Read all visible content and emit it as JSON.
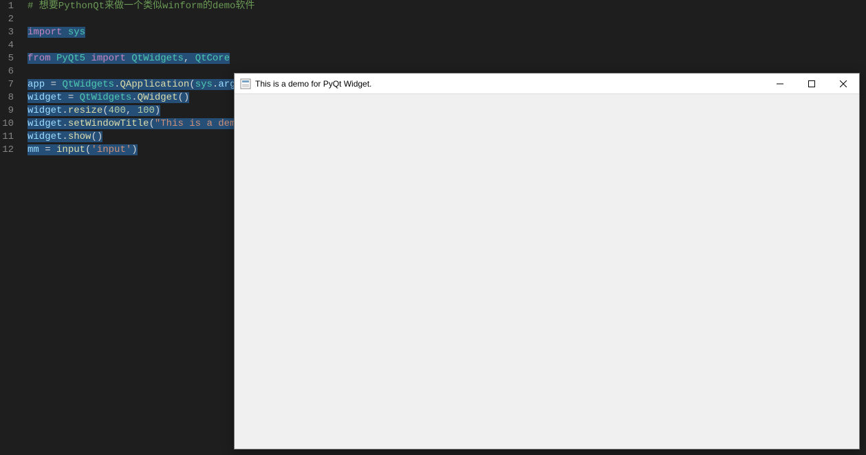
{
  "editor": {
    "lines": [
      {
        "n": 1,
        "tokens": [
          {
            "t": "# 想要PythonQt来做一个类似winform的demo软件",
            "c": "cm"
          }
        ]
      },
      {
        "n": 2,
        "tokens": []
      },
      {
        "n": 3,
        "tokens": [
          {
            "t": "import",
            "c": "kw"
          },
          {
            "t": " ",
            "c": "pn"
          },
          {
            "t": "sys",
            "c": "mod"
          }
        ],
        "selected": true
      },
      {
        "n": 4,
        "tokens": []
      },
      {
        "n": 5,
        "tokens": [
          {
            "t": "from",
            "c": "kw"
          },
          {
            "t": " ",
            "c": "pn"
          },
          {
            "t": "PyQt5",
            "c": "mod"
          },
          {
            "t": " ",
            "c": "pn"
          },
          {
            "t": "import",
            "c": "kw"
          },
          {
            "t": " ",
            "c": "pn"
          },
          {
            "t": "QtWidgets",
            "c": "mod"
          },
          {
            "t": ", ",
            "c": "pn"
          },
          {
            "t": "QtCore",
            "c": "mod"
          }
        ],
        "selected": true
      },
      {
        "n": 6,
        "tokens": []
      },
      {
        "n": 7,
        "tokens": [
          {
            "t": "app",
            "c": "id"
          },
          {
            "t": " = ",
            "c": "pn"
          },
          {
            "t": "QtWidgets",
            "c": "mod"
          },
          {
            "t": ".",
            "c": "pn"
          },
          {
            "t": "QApplication",
            "c": "fn"
          },
          {
            "t": "(",
            "c": "pn"
          },
          {
            "t": "sys",
            "c": "mod"
          },
          {
            "t": ".",
            "c": "pn"
          },
          {
            "t": "argv",
            "c": "id"
          },
          {
            "t": ")",
            "c": "pn"
          }
        ],
        "selected": true
      },
      {
        "n": 8,
        "tokens": [
          {
            "t": "widget",
            "c": "id"
          },
          {
            "t": " = ",
            "c": "pn"
          },
          {
            "t": "QtWidgets",
            "c": "mod"
          },
          {
            "t": ".",
            "c": "pn"
          },
          {
            "t": "QWidget",
            "c": "fn"
          },
          {
            "t": "()",
            "c": "pn"
          }
        ],
        "selected": true
      },
      {
        "n": 9,
        "tokens": [
          {
            "t": "widget",
            "c": "id"
          },
          {
            "t": ".",
            "c": "pn"
          },
          {
            "t": "resize",
            "c": "fn"
          },
          {
            "t": "(",
            "c": "pn"
          },
          {
            "t": "400",
            "c": "num"
          },
          {
            "t": ", ",
            "c": "pn"
          },
          {
            "t": "100",
            "c": "num"
          },
          {
            "t": ")",
            "c": "pn"
          }
        ],
        "selected": true
      },
      {
        "n": 10,
        "tokens": [
          {
            "t": "widget",
            "c": "id"
          },
          {
            "t": ".",
            "c": "pn"
          },
          {
            "t": "setWindowTitle",
            "c": "fn"
          },
          {
            "t": "(",
            "c": "pn"
          },
          {
            "t": "\"This is a demo f",
            "c": "str"
          }
        ],
        "selected": true
      },
      {
        "n": 11,
        "tokens": [
          {
            "t": "widget",
            "c": "id"
          },
          {
            "t": ".",
            "c": "pn"
          },
          {
            "t": "show",
            "c": "fn"
          },
          {
            "t": "()",
            "c": "pn"
          }
        ],
        "selected": true
      },
      {
        "n": 12,
        "tokens": [
          {
            "t": "mm",
            "c": "id"
          },
          {
            "t": " = ",
            "c": "pn"
          },
          {
            "t": "input",
            "c": "fn"
          },
          {
            "t": "(",
            "c": "pn"
          },
          {
            "t": "'input'",
            "c": "str"
          },
          {
            "t": ")",
            "c": "pn"
          }
        ],
        "selected": true
      }
    ]
  },
  "window": {
    "title": "This is a demo for PyQt Widget.",
    "icon": "app-icon",
    "controls": {
      "minimize": "minimize",
      "maximize": "maximize",
      "close": "close"
    }
  }
}
